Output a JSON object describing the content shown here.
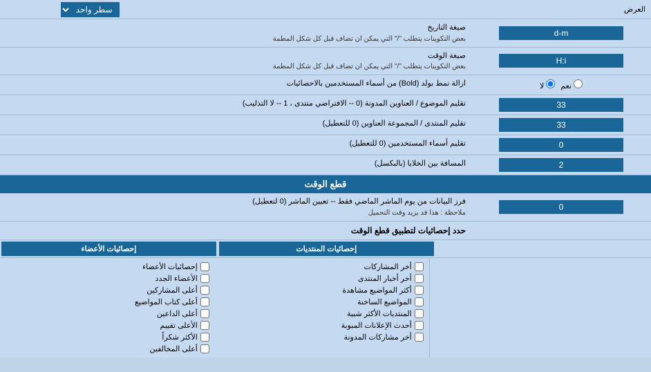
{
  "header": {
    "title": "العرض",
    "display_label": "سطر واحد"
  },
  "rows": [
    {
      "id": "date_format",
      "label": "صيغة التاريخ\nبعض التكوينات يتطلب \"/\" التي يمكن ان تضاف قبل كل شكل المطمة",
      "label_line1": "صيغة التاريخ",
      "label_line2": "بعض التكوينات يتطلب \"/\" التي يمكن ان تضاف قبل كل شكل المطمة",
      "value": "d-m"
    },
    {
      "id": "time_format",
      "label_line1": "صيغة الوقت",
      "label_line2": "بعض التكوينات يتطلب \"/\" التي يمكن ان تضاف قبل كل شكل المطمة",
      "value": "H:i"
    },
    {
      "id": "bold_names",
      "label": "ازالة نمط بولد (Bold) من أسماء المستخدمين بالاحصائيات",
      "radio_yes": "نعم",
      "radio_no": "لا",
      "selected": "no"
    },
    {
      "id": "topic_order",
      "label": "تقليم الموضوع / العناوين المدونة (0 -- الافتراضي منتدى ، 1 -- لا التذليب)",
      "value": "33"
    },
    {
      "id": "forum_order",
      "label": "تقليم المنتدى / المجموعة العناوين (0 للتعطيل)",
      "value": "33"
    },
    {
      "id": "username_trim",
      "label": "تقليم أسماء المستخدمين (0 للتعطيل)",
      "value": "0"
    },
    {
      "id": "cell_spacing",
      "label": "المسافة بين الخلايا (بالبكسل)",
      "value": "2"
    }
  ],
  "cutoff_section": {
    "header": "قطع الوقت",
    "cutoff_row": {
      "label_line1": "فرز البيانات من يوم الماشر الماضي فقط -- تعيين الماشر (0 لتعطيل)",
      "label_line2": "ملاحظة : هذا قد يزيد وقت التحميل",
      "value": "0"
    },
    "stats_apply_label": "حدد إحصائيات لتطبيق قطع الوقت"
  },
  "stats_columns": {
    "posts_header": "إحصائيات المنتديات",
    "members_header": "إحصائيات الأعضاء",
    "posts_items": [
      {
        "label": "أخر المشاركات",
        "checked": false
      },
      {
        "label": "أخر أخبار المنتدى",
        "checked": false
      },
      {
        "label": "أكثر المواضيع مشاهدة",
        "checked": false
      },
      {
        "label": "المواضيع الساخنة",
        "checked": false
      },
      {
        "label": "المنتديات الأكثر شبية",
        "checked": false
      },
      {
        "label": "أحدث الإعلانات المبوبة",
        "checked": false
      },
      {
        "label": "أخر مشاركات المدونة",
        "checked": false
      }
    ],
    "members_items": [
      {
        "label": "إحصائيات الأعضاء",
        "checked": false
      },
      {
        "label": "الأعضاء الجدد",
        "checked": false
      },
      {
        "label": "أعلى المشاركين",
        "checked": false
      },
      {
        "label": "أعلى كتاب المواضيع",
        "checked": false
      },
      {
        "label": "أعلى الداعين",
        "checked": false
      },
      {
        "label": "الأعلى تقييم",
        "checked": false
      },
      {
        "label": "الأكثر شكراً",
        "checked": false
      },
      {
        "label": "أعلى المخالفين",
        "checked": false
      }
    ]
  }
}
